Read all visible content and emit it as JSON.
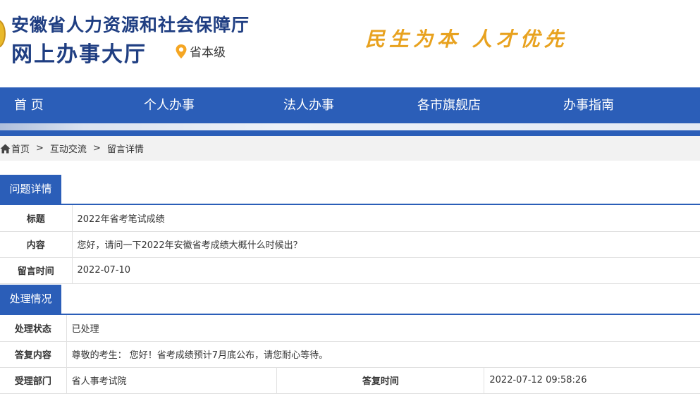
{
  "header": {
    "title_line1": "安徽省人力资源和社会保障厅",
    "title_line2": "网上办事大厅",
    "level_icon": "location-pin-icon",
    "level_text": "省本级",
    "slogan": "民生为本 人才优先"
  },
  "nav": {
    "items": [
      {
        "label": "首 页"
      },
      {
        "label": "个人办事"
      },
      {
        "label": "法人办事"
      },
      {
        "label": "各市旗舰店"
      },
      {
        "label": "办事指南"
      }
    ]
  },
  "breadcrumb": {
    "icon": "home-icon",
    "items": [
      "首页",
      "互动交流",
      "留言详情"
    ],
    "separator": ">"
  },
  "question": {
    "section_title": "问题详情",
    "rows": [
      {
        "label": "标题",
        "value": "2022年省考笔试成绩"
      },
      {
        "label": "内容",
        "value": "您好，请问一下2022年安徽省考成绩大概什么时候出？"
      },
      {
        "label": "留言时间",
        "value": "2022-07-10"
      }
    ]
  },
  "handling": {
    "section_title": "处理情况",
    "status_label": "处理状态",
    "status_value": "已处理",
    "reply_label": "答复内容",
    "reply_value": "尊敬的考生： 您好！省考成绩预计7月底公布，请您耐心等待。",
    "dept_label": "受理部门",
    "dept_value": "省人事考试院",
    "reply_time_label": "答复时间",
    "reply_time_value": "2022-07-12 09:58:26"
  },
  "colors": {
    "brand_blue": "#2b5eb8",
    "title_blue": "#1f3e82",
    "slogan_orange": "#e8a21f",
    "pin_orange": "#f5a623"
  }
}
